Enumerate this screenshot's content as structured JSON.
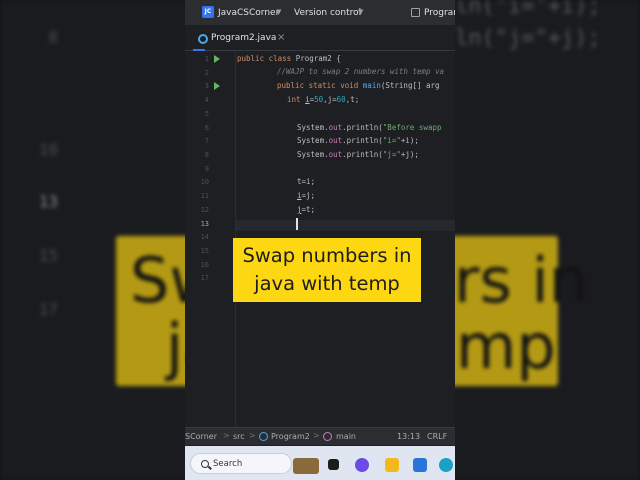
{
  "titlebar": {
    "project_badge": "JC",
    "project_name": "JavaCSCorner",
    "vcs_label": "Version control",
    "run_config": "Program"
  },
  "tab": {
    "label": "Program2.java",
    "close": "×"
  },
  "editor": {
    "line_numbers": [
      "1",
      "2",
      "3",
      "4",
      "5",
      "6",
      "7",
      "8",
      "9",
      "10",
      "11",
      "12",
      "13",
      "14",
      "15",
      "16",
      "17"
    ],
    "current_line": "13",
    "lines": {
      "l1_kw": "public class ",
      "l1_rest": "Program2 {",
      "l2": "//WAJP to swap 2 numbers with temp va",
      "l3_kw": "public static void ",
      "l3_fn": "main",
      "l3_rest": "(String[] arg",
      "l4_kw": "int ",
      "l4_a": "i",
      "l4_b": "=",
      "l4_n1": "50",
      "l4_c": ",j=",
      "l4_n2": "60",
      "l4_d": ",t;",
      "l6_a": "System.",
      "l6_f": "out",
      "l6_b": ".println(",
      "l6_s": "\"Before swapp",
      "l7_a": "System.",
      "l7_f": "out",
      "l7_b": ".println(",
      "l7_s": "\"i=\"",
      "l7_c": "+i);",
      "l8_a": "System.",
      "l8_f": "out",
      "l8_b": ".println(",
      "l8_s": "\"j=\"",
      "l8_c": "+j);",
      "l10": "t=i;",
      "l11_u": "i",
      "l11_r": "=j;",
      "l12_u": "j",
      "l12_r": "=t;"
    }
  },
  "statusbar": {
    "project": "SCorner",
    "src": "src",
    "file": "Program2",
    "method": "main",
    "position": "13:13",
    "line_sep": "CRLF",
    "sep": ">"
  },
  "taskbar": {
    "search_label": "Search"
  },
  "caption": {
    "line1": "Swap numbers in",
    "line2": "java with temp"
  },
  "background": {
    "code_top_1": "ln(\"i=\"+i);",
    "code_top_2": "ln(\"j=\"+j);",
    "banner_l1_left": "Sw",
    "banner_l1_right": "rs in",
    "banner_l2_left": "ja",
    "banner_l2_right": "mp",
    "gutter": [
      "8",
      "10",
      "13",
      "15",
      "17"
    ]
  },
  "colors": {
    "caption_bg": "#fdd711",
    "editor_bg": "#1e1f22",
    "accent": "#3574f0",
    "keyword": "#cf8e6d",
    "string": "#6aab73",
    "number": "#2aacb8"
  }
}
